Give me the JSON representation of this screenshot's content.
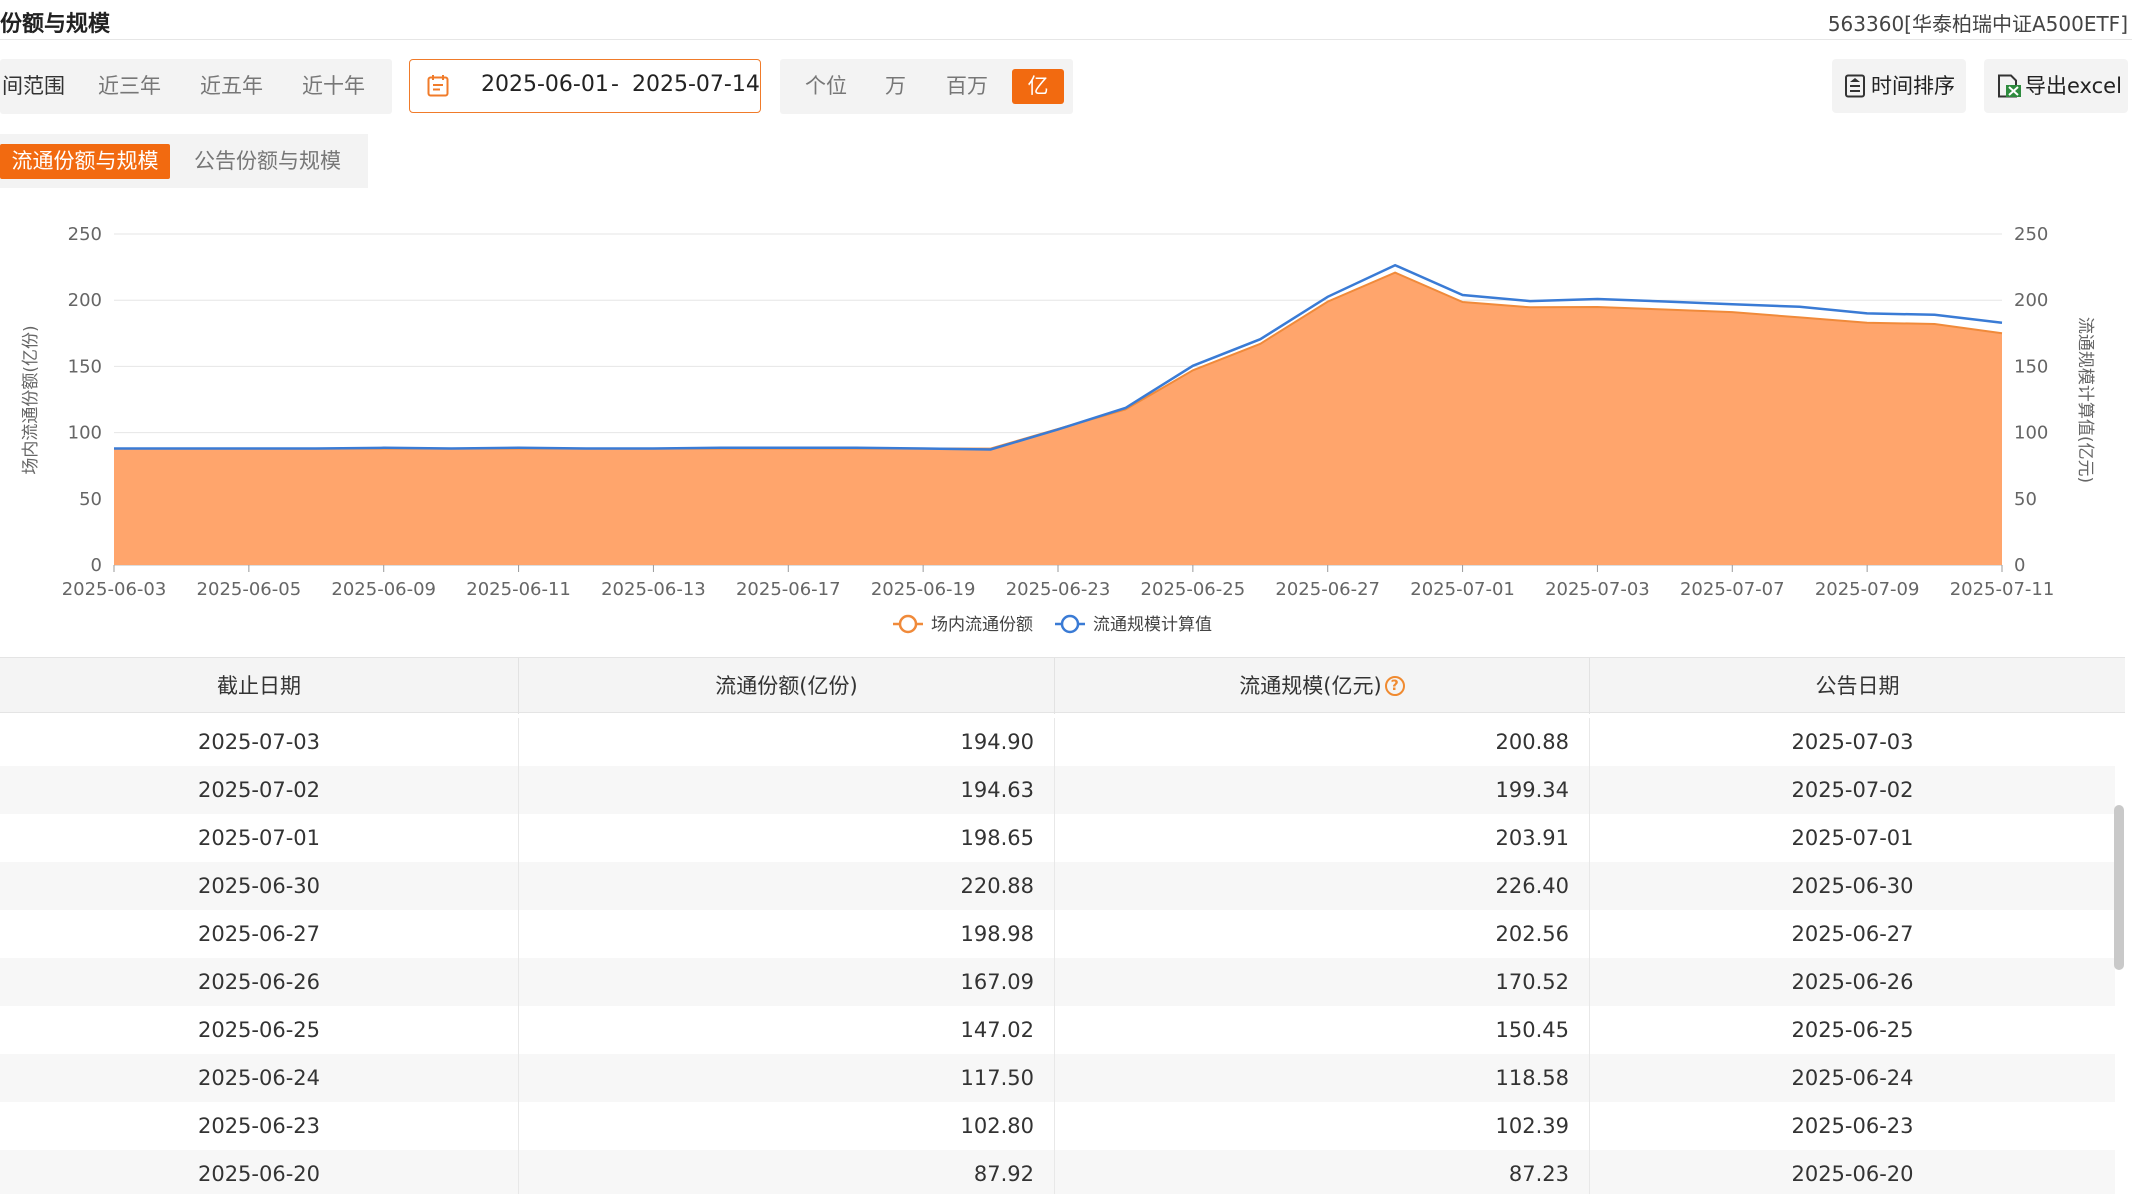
{
  "header": {
    "title": "份额与规模",
    "fund": "563360[华泰柏瑞中证A500ETF]"
  },
  "toolbar": {
    "range_label": "间范围",
    "ranges": [
      "近三年",
      "近五年",
      "近十年"
    ],
    "date_from": "2025-06-01",
    "date_sep": "-",
    "date_to": "2025-07-14",
    "units": [
      "个位",
      "万",
      "百万",
      "亿"
    ],
    "active_unit": "亿",
    "sort_label": "时间排序",
    "export_label": "导出excel"
  },
  "tabs": {
    "active": "流通份额与规模",
    "other": "公告份额与规模"
  },
  "colors": {
    "accent": "#f26a10",
    "area": "#ffa56c",
    "area_line": "#f08a3a",
    "scale_line": "#3a7bd5"
  },
  "chart_data": {
    "type": "area",
    "x": [
      "2025-06-03",
      "2025-06-04",
      "2025-06-05",
      "2025-06-06",
      "2025-06-09",
      "2025-06-10",
      "2025-06-11",
      "2025-06-12",
      "2025-06-13",
      "2025-06-16",
      "2025-06-17",
      "2025-06-18",
      "2025-06-19",
      "2025-06-20",
      "2025-06-23",
      "2025-06-24",
      "2025-06-25",
      "2025-06-26",
      "2025-06-27",
      "2025-06-30",
      "2025-07-01",
      "2025-07-02",
      "2025-07-03",
      "2025-07-04",
      "2025-07-07",
      "2025-07-08",
      "2025-07-09",
      "2025-07-10",
      "2025-07-11"
    ],
    "x_tick_labels": [
      "2025-06-03",
      "2025-06-05",
      "2025-06-09",
      "2025-06-11",
      "2025-06-13",
      "2025-06-17",
      "2025-06-19",
      "2025-06-23",
      "2025-06-25",
      "2025-06-27",
      "2025-07-01",
      "2025-07-03",
      "2025-07-07",
      "2025-07-09",
      "2025-07-11"
    ],
    "series": [
      {
        "name": "场内流通份额",
        "axis": "left",
        "style": "area",
        "values": [
          88,
          88,
          88,
          88,
          88,
          88,
          88,
          88,
          88,
          88,
          88,
          88,
          88,
          87.92,
          102.8,
          117.5,
          147.02,
          167.09,
          198.98,
          220.88,
          198.65,
          194.63,
          194.9,
          193,
          191,
          187,
          183,
          182,
          175
        ]
      },
      {
        "name": "流通规模计算值",
        "axis": "right",
        "style": "line",
        "values": [
          88,
          88,
          88,
          88,
          88.5,
          88,
          88.5,
          88,
          88,
          88.5,
          88.5,
          88.5,
          88,
          87.23,
          102.39,
          118.58,
          150.45,
          170.52,
          202.56,
          226.4,
          203.91,
          199.34,
          200.88,
          199,
          197,
          195,
          190,
          189,
          183
        ]
      }
    ],
    "ylabel_left": "场内流通份额(亿份)",
    "ylabel_right": "流通规模计算值(亿元)",
    "ylim": [
      0,
      250
    ],
    "y_ticks": [
      0,
      50,
      100,
      150,
      200,
      250
    ],
    "legend": "bottom-center",
    "grid": true
  },
  "table": {
    "columns": [
      "截止日期",
      "流通份额(亿份)",
      "流通规模(亿元)",
      "公告日期"
    ],
    "help_icon": "?",
    "rows": [
      [
        "2025-07-03",
        "194.90",
        "200.88",
        "2025-07-03"
      ],
      [
        "2025-07-02",
        "194.63",
        "199.34",
        "2025-07-02"
      ],
      [
        "2025-07-01",
        "198.65",
        "203.91",
        "2025-07-01"
      ],
      [
        "2025-06-30",
        "220.88",
        "226.40",
        "2025-06-30"
      ],
      [
        "2025-06-27",
        "198.98",
        "202.56",
        "2025-06-27"
      ],
      [
        "2025-06-26",
        "167.09",
        "170.52",
        "2025-06-26"
      ],
      [
        "2025-06-25",
        "147.02",
        "150.45",
        "2025-06-25"
      ],
      [
        "2025-06-24",
        "117.50",
        "118.58",
        "2025-06-24"
      ],
      [
        "2025-06-23",
        "102.80",
        "102.39",
        "2025-06-23"
      ],
      [
        "2025-06-20",
        "87.92",
        "87.23",
        "2025-06-20"
      ]
    ]
  }
}
